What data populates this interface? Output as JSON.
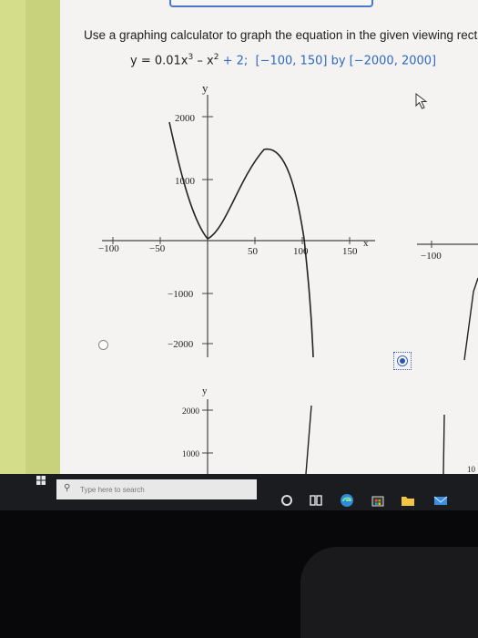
{
  "question": {
    "prompt": "Use a graphing calculator to graph the equation in the given viewing rectangle.",
    "eq_y": "y = 0.01x",
    "eq_exp3": "3",
    "eq_minus": " – x",
    "eq_exp2": "2",
    "eq_const": " + 2;",
    "eq_window": "[−100, 150] by [−2000, 2000]"
  },
  "option_c": {
    "y_axis_label": "y",
    "x_axis_label": "x",
    "y_ticks": [
      "2000",
      "1000",
      "−1000",
      "−2000"
    ],
    "x_ticks": [
      "−100",
      "−50",
      "50",
      "100",
      "150"
    ]
  },
  "option_d_partial": {
    "x_tick": "−100"
  },
  "option_e_partial": {
    "y_axis_label": "y",
    "y_ticks": [
      "2000",
      "1000"
    ],
    "right_edge_label": "10"
  },
  "taskbar": {
    "search_placeholder": "Type here to search"
  },
  "colors": {
    "accent": "#2d6ac4",
    "stripe": "#d4dd8a",
    "taskbar": "#1b1c20"
  }
}
